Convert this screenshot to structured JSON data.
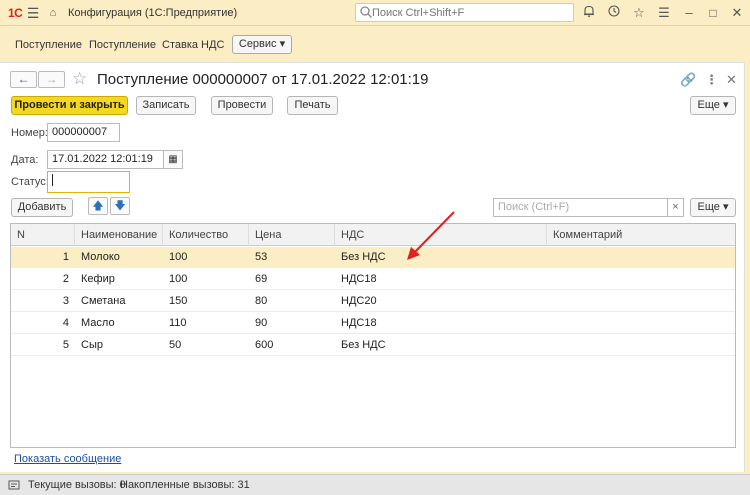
{
  "titlebar": {
    "logo": "1С",
    "app_title": "Конфигурация  (1С:Предприятие)",
    "search_placeholder": "Поиск Ctrl+Shift+F"
  },
  "sections": {
    "items": [
      "Поступление",
      "Поступление",
      "Ставка НДС"
    ],
    "service_label": "Сервис ▾"
  },
  "form": {
    "title": "Поступление 000000007 от 17.01.2022 12:01:19",
    "buttons": {
      "post_close": "Провести и закрыть",
      "save": "Записать",
      "post": "Провести",
      "print": "Печать",
      "more": "Еще ▾"
    },
    "fields": {
      "number_label": "Номер:",
      "number_value": "000000007",
      "date_label": "Дата:",
      "date_value": "17.01.2022 12:01:19",
      "status_label": "Статус:",
      "status_value": ""
    },
    "table_toolbar": {
      "add_label": "Добавить",
      "search_placeholder": "Поиск (Ctrl+F)",
      "more": "Еще ▾"
    },
    "table": {
      "columns": [
        "N",
        "Наименование",
        "Количество",
        "Цена",
        "НДС",
        "Комментарий"
      ],
      "rows": [
        {
          "n": "1",
          "name": "Молоко",
          "qty": "100",
          "price": "53",
          "vat": "Без НДС",
          "comment": ""
        },
        {
          "n": "2",
          "name": "Кефир",
          "qty": "100",
          "price": "69",
          "vat": "НДС18",
          "comment": ""
        },
        {
          "n": "3",
          "name": "Сметана",
          "qty": "150",
          "price": "80",
          "vat": "НДС20",
          "comment": ""
        },
        {
          "n": "4",
          "name": "Масло",
          "qty": "110",
          "price": "90",
          "vat": "НДС18",
          "comment": ""
        },
        {
          "n": "5",
          "name": "Сыр",
          "qty": "50",
          "price": "600",
          "vat": "Без НДС",
          "comment": ""
        }
      ]
    },
    "show_message": "Показать сообщение"
  },
  "statusbar": {
    "current_calls": "Текущие вызовы: 0",
    "accumulated_calls": "Накопленные вызовы: 31"
  },
  "colors": {
    "chrome": "#fbedc4",
    "primary_button": "#f5d620",
    "selected_row": "#fbedc4",
    "annotation_arrow": "#e02020",
    "link": "#1c4fa0"
  }
}
